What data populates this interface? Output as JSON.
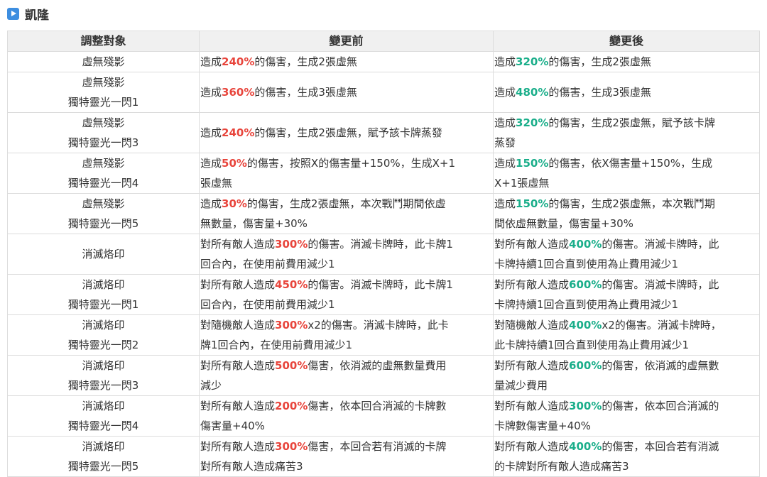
{
  "title": "凱隆",
  "colors": {
    "before_highlight": "#e8453c",
    "after_highlight": "#1aae8a",
    "header_bg": "#f0f0f0",
    "icon": "#3d8ee0"
  },
  "headers": [
    "調整對象",
    "變更前",
    "變更後"
  ],
  "rows": [
    {
      "target": "虛無殘影",
      "before": {
        "pre": "造成",
        "num": "240%",
        "post": "的傷害，生成2張虛無"
      },
      "after": {
        "pre": "造成",
        "num": "320%",
        "post": "的傷害，生成2張虛無"
      }
    },
    {
      "target": "虛無殘影\n獨特靈光一閃1",
      "before": {
        "pre": "造成",
        "num": "360%",
        "post": "的傷害，生成3張虛無"
      },
      "after": {
        "pre": "造成",
        "num": "480%",
        "post": "的傷害，生成3張虛無"
      }
    },
    {
      "target": "虛無殘影\n獨特靈光一閃3",
      "before": {
        "pre": "造成",
        "num": "240%",
        "post": "的傷害，生成2張虛無，賦予該卡牌蒸發"
      },
      "after": {
        "pre": "造成",
        "num": "320%",
        "post": "的傷害，生成2張虛無，賦予該卡牌\n蒸發"
      }
    },
    {
      "target": "虛無殘影\n獨特靈光一閃4",
      "before": {
        "pre": "造成",
        "num": "50%",
        "post": "的傷害，按照X的傷害量+150%，生成X+1\n張虛無"
      },
      "after": {
        "pre": "造成",
        "num": "150%",
        "post": "的傷害，依X傷害量+150%，生成\nX+1張虛無"
      }
    },
    {
      "target": "虛無殘影\n獨特靈光一閃5",
      "before": {
        "pre": "造成",
        "num": "30%",
        "post": "的傷害，生成2張虛無，本次戰鬥期間依虛\n無數量，傷害量+30%"
      },
      "after": {
        "pre": "造成",
        "num": "150%",
        "post": "的傷害，生成2張虛無，本次戰鬥期\n間依虛無數量，傷害量+30%"
      }
    },
    {
      "target": "消滅烙印",
      "before": {
        "pre": "對所有敵人造成",
        "num": "300%",
        "post": "的傷害。消滅卡牌時，此卡牌1\n回合內，在使用前費用減少1"
      },
      "after": {
        "pre": "對所有敵人造成",
        "num": "400%",
        "post": "的傷害。消滅卡牌時，此\n卡牌持續1回合直到使用為止費用減少1"
      }
    },
    {
      "target": "消滅烙印\n獨特靈光一閃1",
      "before": {
        "pre": "對所有敵人造成",
        "num": "450%",
        "post": "的傷害。消滅卡牌時，此卡牌1\n回合內，在使用前費用減少1"
      },
      "after": {
        "pre": "對所有敵人造成",
        "num": "600%",
        "post": "的傷害。消滅卡牌時，此\n卡牌持續1回合直到使用為止費用減少1"
      }
    },
    {
      "target": "消滅烙印\n獨特靈光一閃2",
      "before": {
        "pre": "對隨機敵人造成",
        "num": "300%",
        "post": "x2的傷害。消滅卡牌時，此卡\n牌1回合內，在使用前費用減少1"
      },
      "after": {
        "pre": "對隨機敵人造成",
        "num": "400%",
        "post": "x2的傷害。消滅卡牌時，\n此卡牌持續1回合直到使用為止費用減少1"
      }
    },
    {
      "target": "消滅烙印\n獨特靈光一閃3",
      "before": {
        "pre": "對所有敵人造成",
        "num": "500%",
        "post": "傷害，依消滅的虛無數量費用\n減少"
      },
      "after": {
        "pre": "對所有敵人造成",
        "num": "600%",
        "post": "的傷害，依消滅的虛無數\n量減少費用"
      }
    },
    {
      "target": "消滅烙印\n獨特靈光一閃4",
      "before": {
        "pre": "對所有敵人造成",
        "num": "200%",
        "post": "傷害，依本回合消滅的卡牌數\n傷害量+40%"
      },
      "after": {
        "pre": "對所有敵人造成",
        "num": "300%",
        "post": "的傷害，依本回合消滅的\n卡牌數傷害量+40%"
      }
    },
    {
      "target": "消滅烙印\n獨特靈光一閃5",
      "before": {
        "pre": "對所有敵人造成",
        "num": "300%",
        "post": "傷害，本回合若有消滅的卡牌\n對所有敵人造成痛苦3"
      },
      "after": {
        "pre": "對所有敵人造成",
        "num": "400%",
        "post": "的傷害，本回合若有消滅\n的卡牌對所有敵人造成痛苦3"
      }
    }
  ]
}
